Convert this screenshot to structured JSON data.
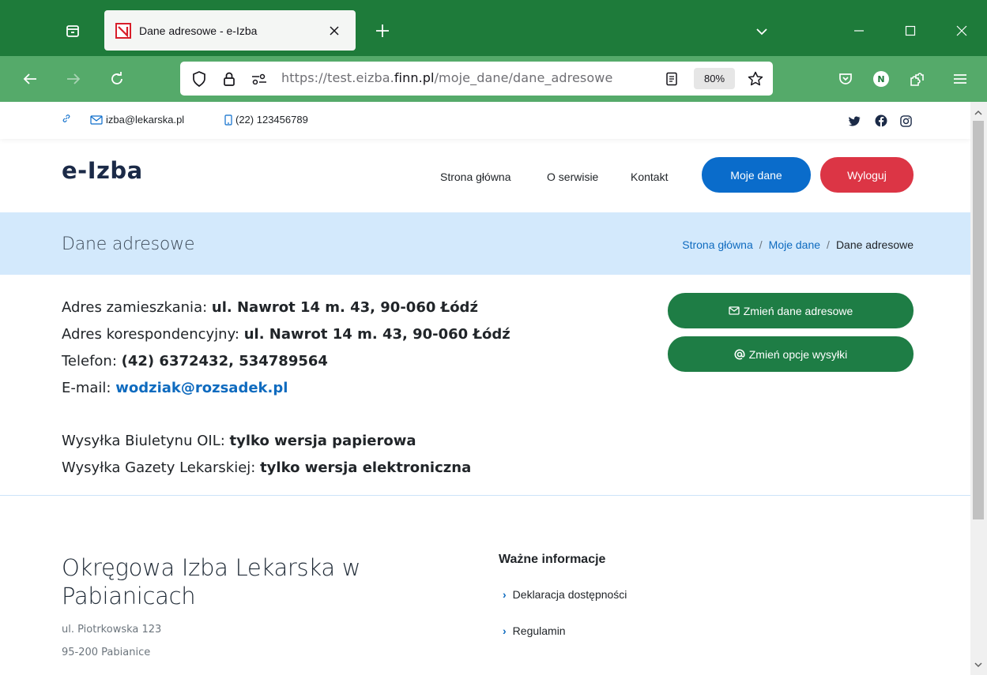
{
  "browser": {
    "tab_title": "Dane adresowe - e-Izba",
    "url_prefix": "https://test.eizba.",
    "url_domain": "finn.pl",
    "url_path": "/moje_dane/dane_adresowe",
    "zoom": "80%"
  },
  "topbar": {
    "email": "izba@lekarska.pl",
    "phone": "(22) 123456789"
  },
  "header": {
    "brand": "e-Izba",
    "menu": [
      "Strona główna",
      "O serwisie",
      "Kontakt"
    ],
    "moje_dane_label": "Moje dane",
    "wyloguj_label": "Wyloguj"
  },
  "pagehead": {
    "title": "Dane adresowe",
    "breadcrumb": [
      "Strona główna",
      "Moje dane",
      "Dane adresowe"
    ],
    "separator": "/"
  },
  "details": {
    "residence_label": "Adres zamieszkania:",
    "residence_value": "ul. Nawrot 14 m. 43, 90-060 Łódź",
    "correspondence_label": "Adres korespondencyjny:",
    "correspondence_value": "ul. Nawrot 14 m. 43, 90-060 Łódź",
    "phone_label": "Telefon:",
    "phone_value": "(42) 6372432, 534789564",
    "email_label": "E-mail:",
    "email_value": "wodziak@rozsadek.pl",
    "bulletin_label": "Wysyłka Biuletynu OIL:",
    "bulletin_value": "tylko wersja papierowa",
    "gazette_label": "Wysyłka Gazety Lekarskiej:",
    "gazette_value": "tylko wersja elektroniczna"
  },
  "actions": {
    "change_address_label": "Zmień dane adresowe",
    "change_shipping_label": "Zmień opcje wysyłki"
  },
  "footer": {
    "org_name": "Okręgowa Izba Lekarska w Pabianicach",
    "address_line1": "ul. Piotrkowska 123",
    "address_line2": "95-200 Pabianice",
    "info_heading": "Ważne informacje",
    "links": [
      "Deklaracja dostępności",
      "Regulamin"
    ]
  },
  "colors": {
    "browser_green": "#1e7b3a",
    "toolbar_green": "#55aa6a",
    "primary_blue": "#0a6ccb",
    "danger_red": "#dc3545",
    "action_green": "#1e7d45",
    "pagehead_bg": "#d3e9fc"
  }
}
